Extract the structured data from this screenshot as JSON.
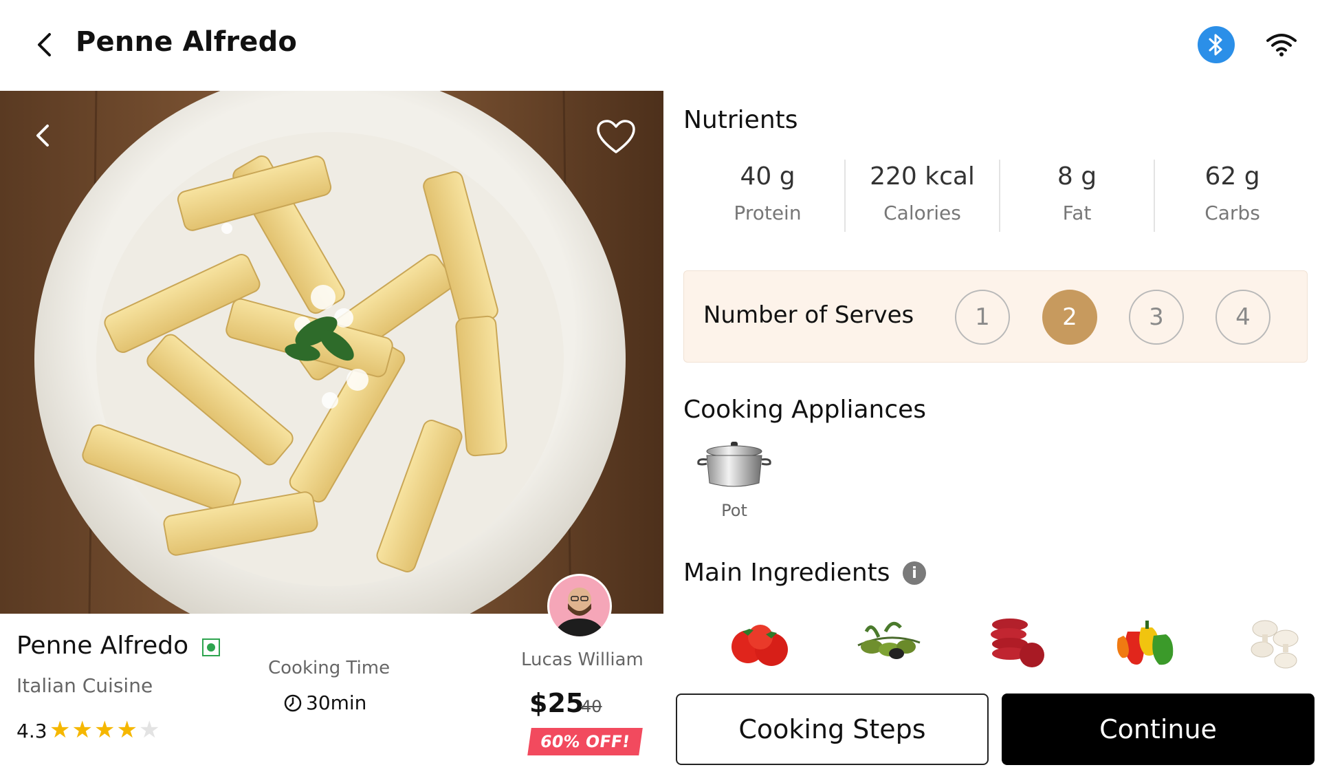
{
  "header": {
    "title": "Penne Alfredo",
    "icons": {
      "back": "chevron-left-icon",
      "bluetooth": "bluetooth-icon",
      "wifi": "wifi-icon"
    },
    "bluetooth_color": "#2b8fe8"
  },
  "hero": {
    "icons": {
      "back": "chevron-left-icon",
      "favorite": "heart-outline-icon"
    }
  },
  "dish": {
    "name": "Penne Alfredo",
    "cuisine": "Italian Cuisine",
    "rating": "4.3",
    "rating_stars": 4,
    "rating_max": 5,
    "veg": true,
    "veg_color": "#2da44e",
    "cooking_time_label": "Cooking Time",
    "cooking_time": "30min"
  },
  "chef": {
    "name": "Lucas William"
  },
  "pricing": {
    "price": "$25",
    "original_price": "40",
    "discount": "60% OFF!",
    "discount_color": "#f24a5e"
  },
  "nutrients": {
    "title": "Nutrients",
    "items": [
      {
        "value": "40 g",
        "label": "Protein"
      },
      {
        "value": "220 kcal",
        "label": "Calories"
      },
      {
        "value": "8 g",
        "label": "Fat"
      },
      {
        "value": "62 g",
        "label": "Carbs"
      }
    ]
  },
  "serves": {
    "label": "Number of Serves",
    "options": [
      "1",
      "2",
      "3",
      "4"
    ],
    "selected": "2",
    "accent_color": "#c79a5e"
  },
  "appliances": {
    "title": "Cooking Appliances",
    "items": [
      {
        "label": "Pot",
        "icon": "pot-icon"
      }
    ]
  },
  "ingredients": {
    "title": "Main Ingredients",
    "info_icon": "info-icon",
    "items": [
      "tomato-icon",
      "olives-icon",
      "salami-icon",
      "bell-peppers-icon",
      "mushrooms-icon"
    ]
  },
  "actions": {
    "cooking_steps": "Cooking Steps",
    "continue": "Continue"
  }
}
